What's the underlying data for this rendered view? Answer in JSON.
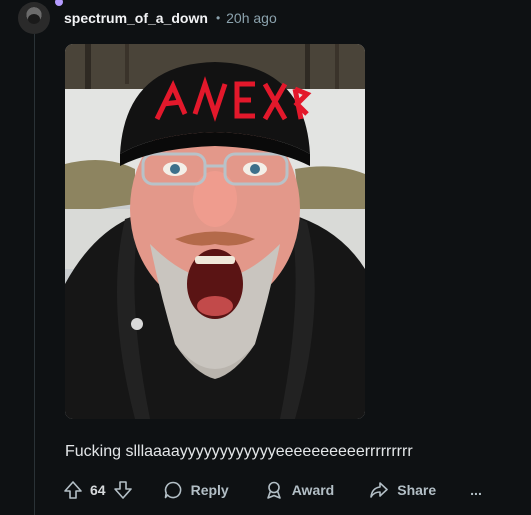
{
  "comment": {
    "author": "spectrum_of_a_down",
    "separator": "•",
    "timestamp": "20h ago",
    "body": "Fucking slllaaaayyyyyyyyyyyyeeeeeeeeeerrrrrrrrr",
    "hat_text": "SLAYER"
  },
  "actions": {
    "vote_count": "64",
    "reply_label": "Reply",
    "award_label": "Award",
    "share_label": "Share",
    "more_label": "..."
  },
  "icons": {
    "upvote": "upvote-icon",
    "downvote": "downvote-icon",
    "reply": "reply-icon",
    "award": "award-icon",
    "share": "share-icon",
    "more": "more-icon"
  },
  "colors": {
    "background": "#0e1113",
    "muted_text": "#8ba2ad",
    "username": "#f2f3f5",
    "action_text": "#b3bfc6"
  }
}
